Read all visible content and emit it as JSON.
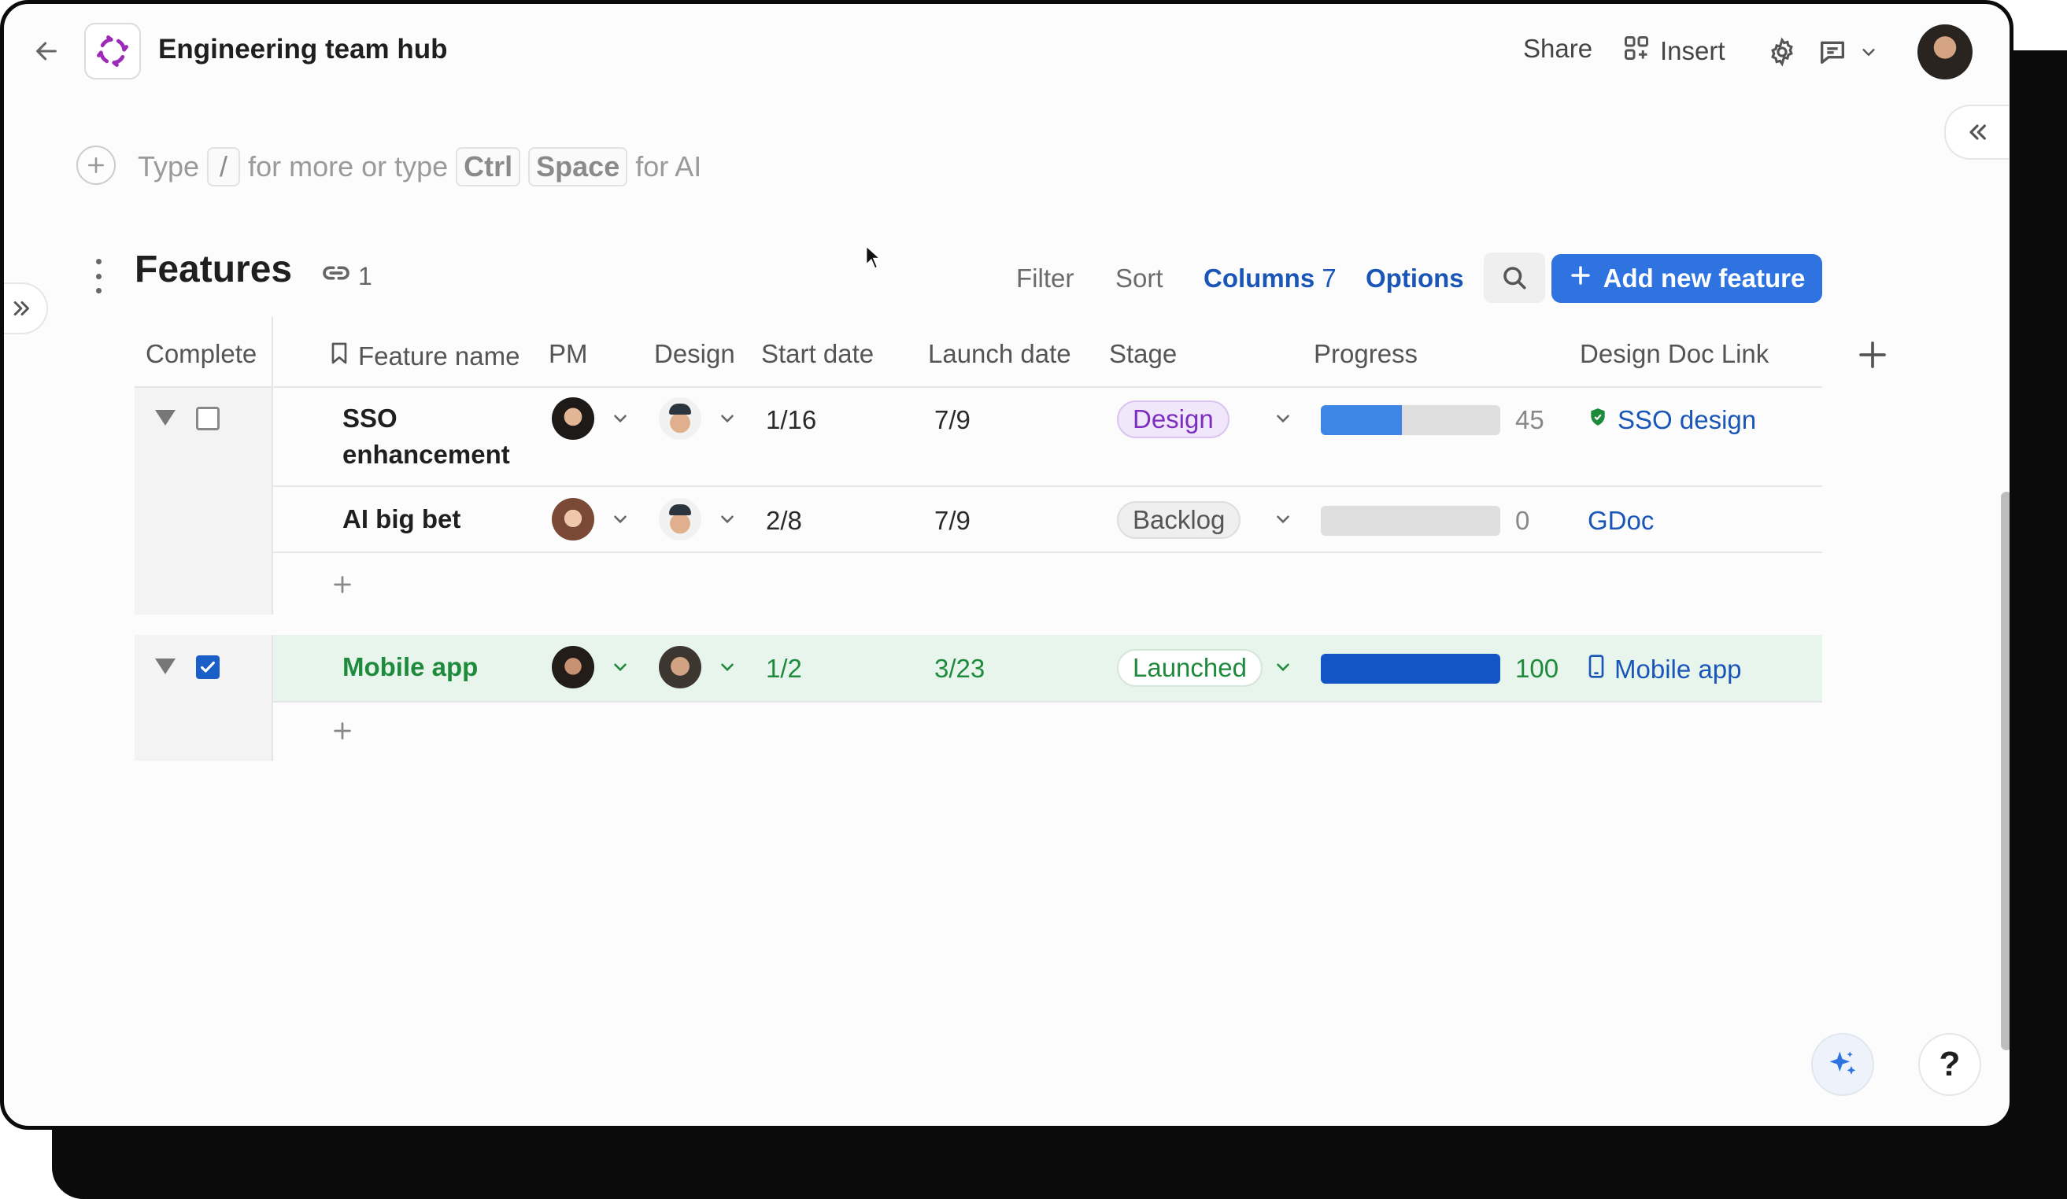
{
  "header": {
    "doc_title": "Engineering team hub",
    "share_label": "Share",
    "insert_label": "Insert"
  },
  "composer": {
    "hint_type": "Type",
    "hint_slash": "/",
    "hint_more": "for more or type",
    "hint_ctrl": "Ctrl",
    "hint_space": "Space",
    "hint_ai": "for AI"
  },
  "table": {
    "title": "Features",
    "link_count": "1",
    "filter_label": "Filter",
    "sort_label": "Sort",
    "columns_label": "Columns",
    "columns_count": "7",
    "options_label": "Options",
    "add_button_label": "Add new feature",
    "columns": [
      "Complete",
      "Feature name",
      "PM",
      "Design",
      "Start date",
      "Launch date",
      "Stage",
      "Progress",
      "Design Doc Link"
    ],
    "groups": [
      {
        "complete": false,
        "rows": [
          {
            "feature": "SSO enhancement",
            "start": "1/16",
            "launch": "7/9",
            "stage": "Design",
            "progress": 45,
            "progress_label": "45",
            "doc": "SSO design",
            "doc_icon": "shield-icon"
          },
          {
            "feature": "AI big bet",
            "start": "2/8",
            "launch": "7/9",
            "stage": "Backlog",
            "progress": 0,
            "progress_label": "0",
            "doc": "GDoc",
            "doc_icon": ""
          }
        ]
      },
      {
        "complete": true,
        "rows": [
          {
            "feature": "Mobile app",
            "start": "1/2",
            "launch": "3/23",
            "stage": "Launched",
            "progress": 100,
            "progress_label": "100",
            "doc": "Mobile app",
            "doc_icon": "phone-icon"
          }
        ]
      }
    ]
  },
  "colors": {
    "accent": "#2e73e0",
    "link": "#1a56b8",
    "complete_green": "#1e8a3c",
    "complete_row_bg": "#e8f5ec",
    "design_pill": "#7c2fbf"
  },
  "help_label": "?"
}
